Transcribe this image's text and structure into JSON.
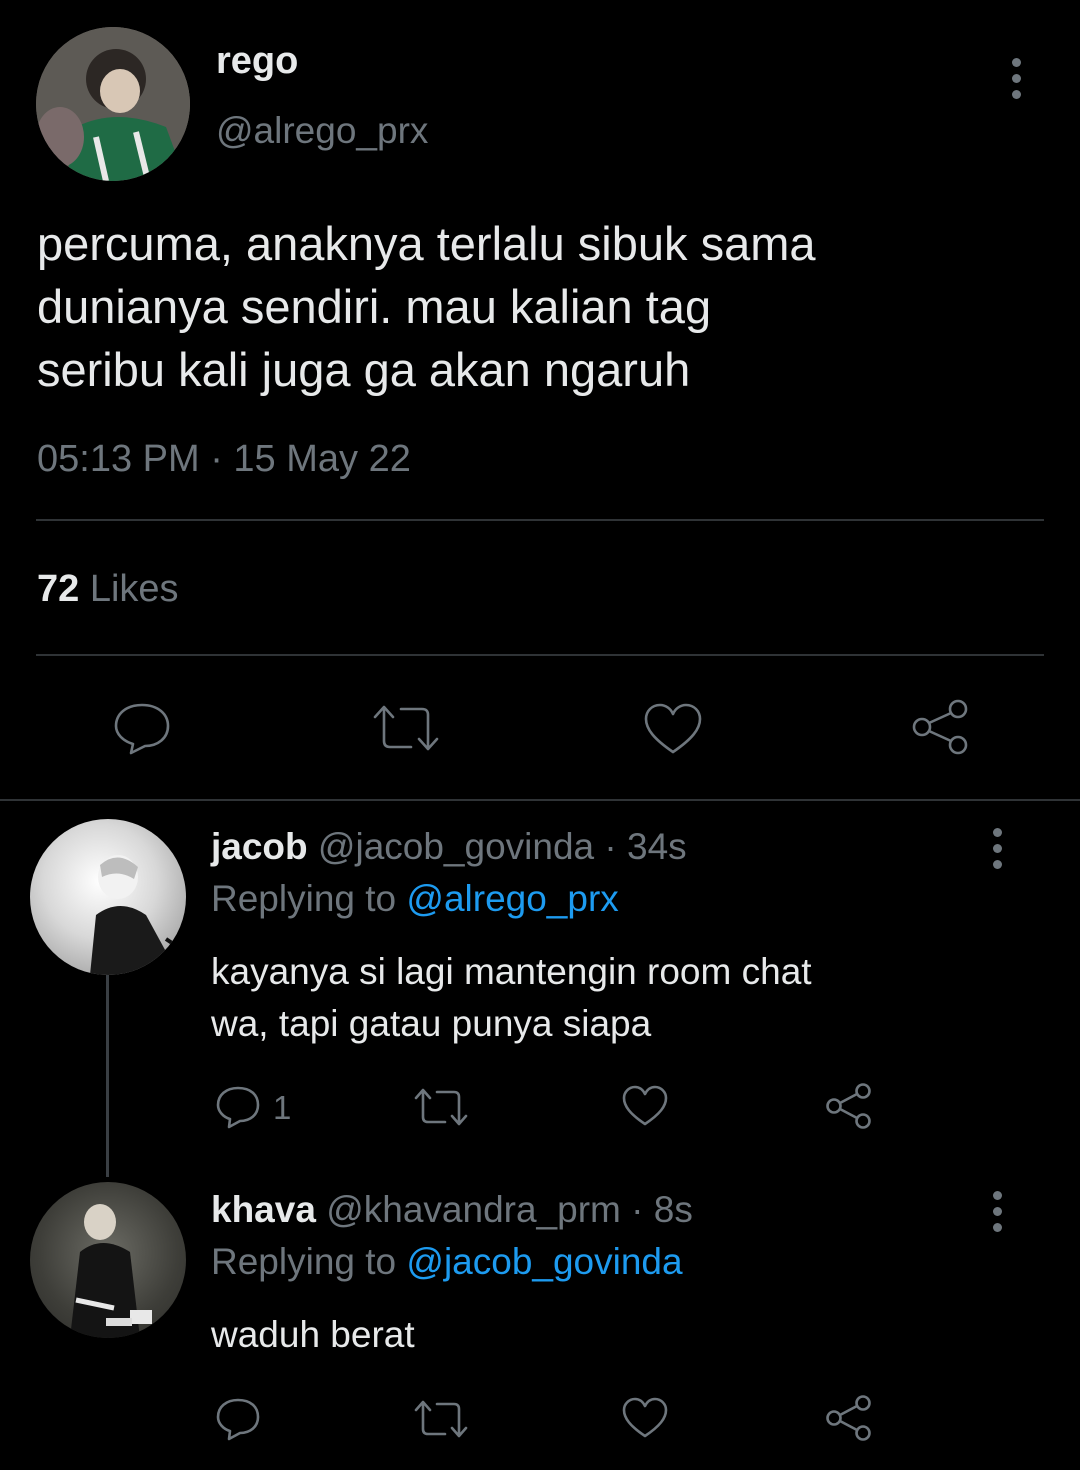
{
  "main_tweet": {
    "display_name": "rego",
    "handle": "@alrego_prx",
    "text_lines": [
      "percuma, anaknya terlalu sibuk sama",
      "dunianya sendiri. mau kalian tag",
      "seribu kali juga ga akan ngaruh"
    ],
    "timestamp": "05:13 PM · 15 May 22",
    "likes_count": "72",
    "likes_label": "Likes",
    "avatar_icon": "avatar-photo"
  },
  "replies": [
    {
      "display_name": "jacob",
      "handle": "@jacob_govinda",
      "time": "· 34s",
      "replying_label": "Replying to",
      "replying_to": "@alrego_prx",
      "text_lines": [
        "kayanya si lagi mantengin room chat",
        "wa, tapi gatau punya siapa"
      ],
      "reply_count": "1"
    },
    {
      "display_name": "khava",
      "handle": "@khavandra_prm",
      "time": "· 8s",
      "replying_label": "Replying to",
      "replying_to": "@jacob_govinda",
      "text_lines": [
        "waduh berat"
      ],
      "reply_count": ""
    }
  ],
  "icons": [
    "reply-icon",
    "retweet-icon",
    "like-icon",
    "share-icon",
    "more-options-icon"
  ],
  "colors": {
    "background": "#000000",
    "text": "#e7e9ea",
    "secondary": "#6e767d",
    "link": "#1d9bf0",
    "divider": "#2f3336"
  }
}
